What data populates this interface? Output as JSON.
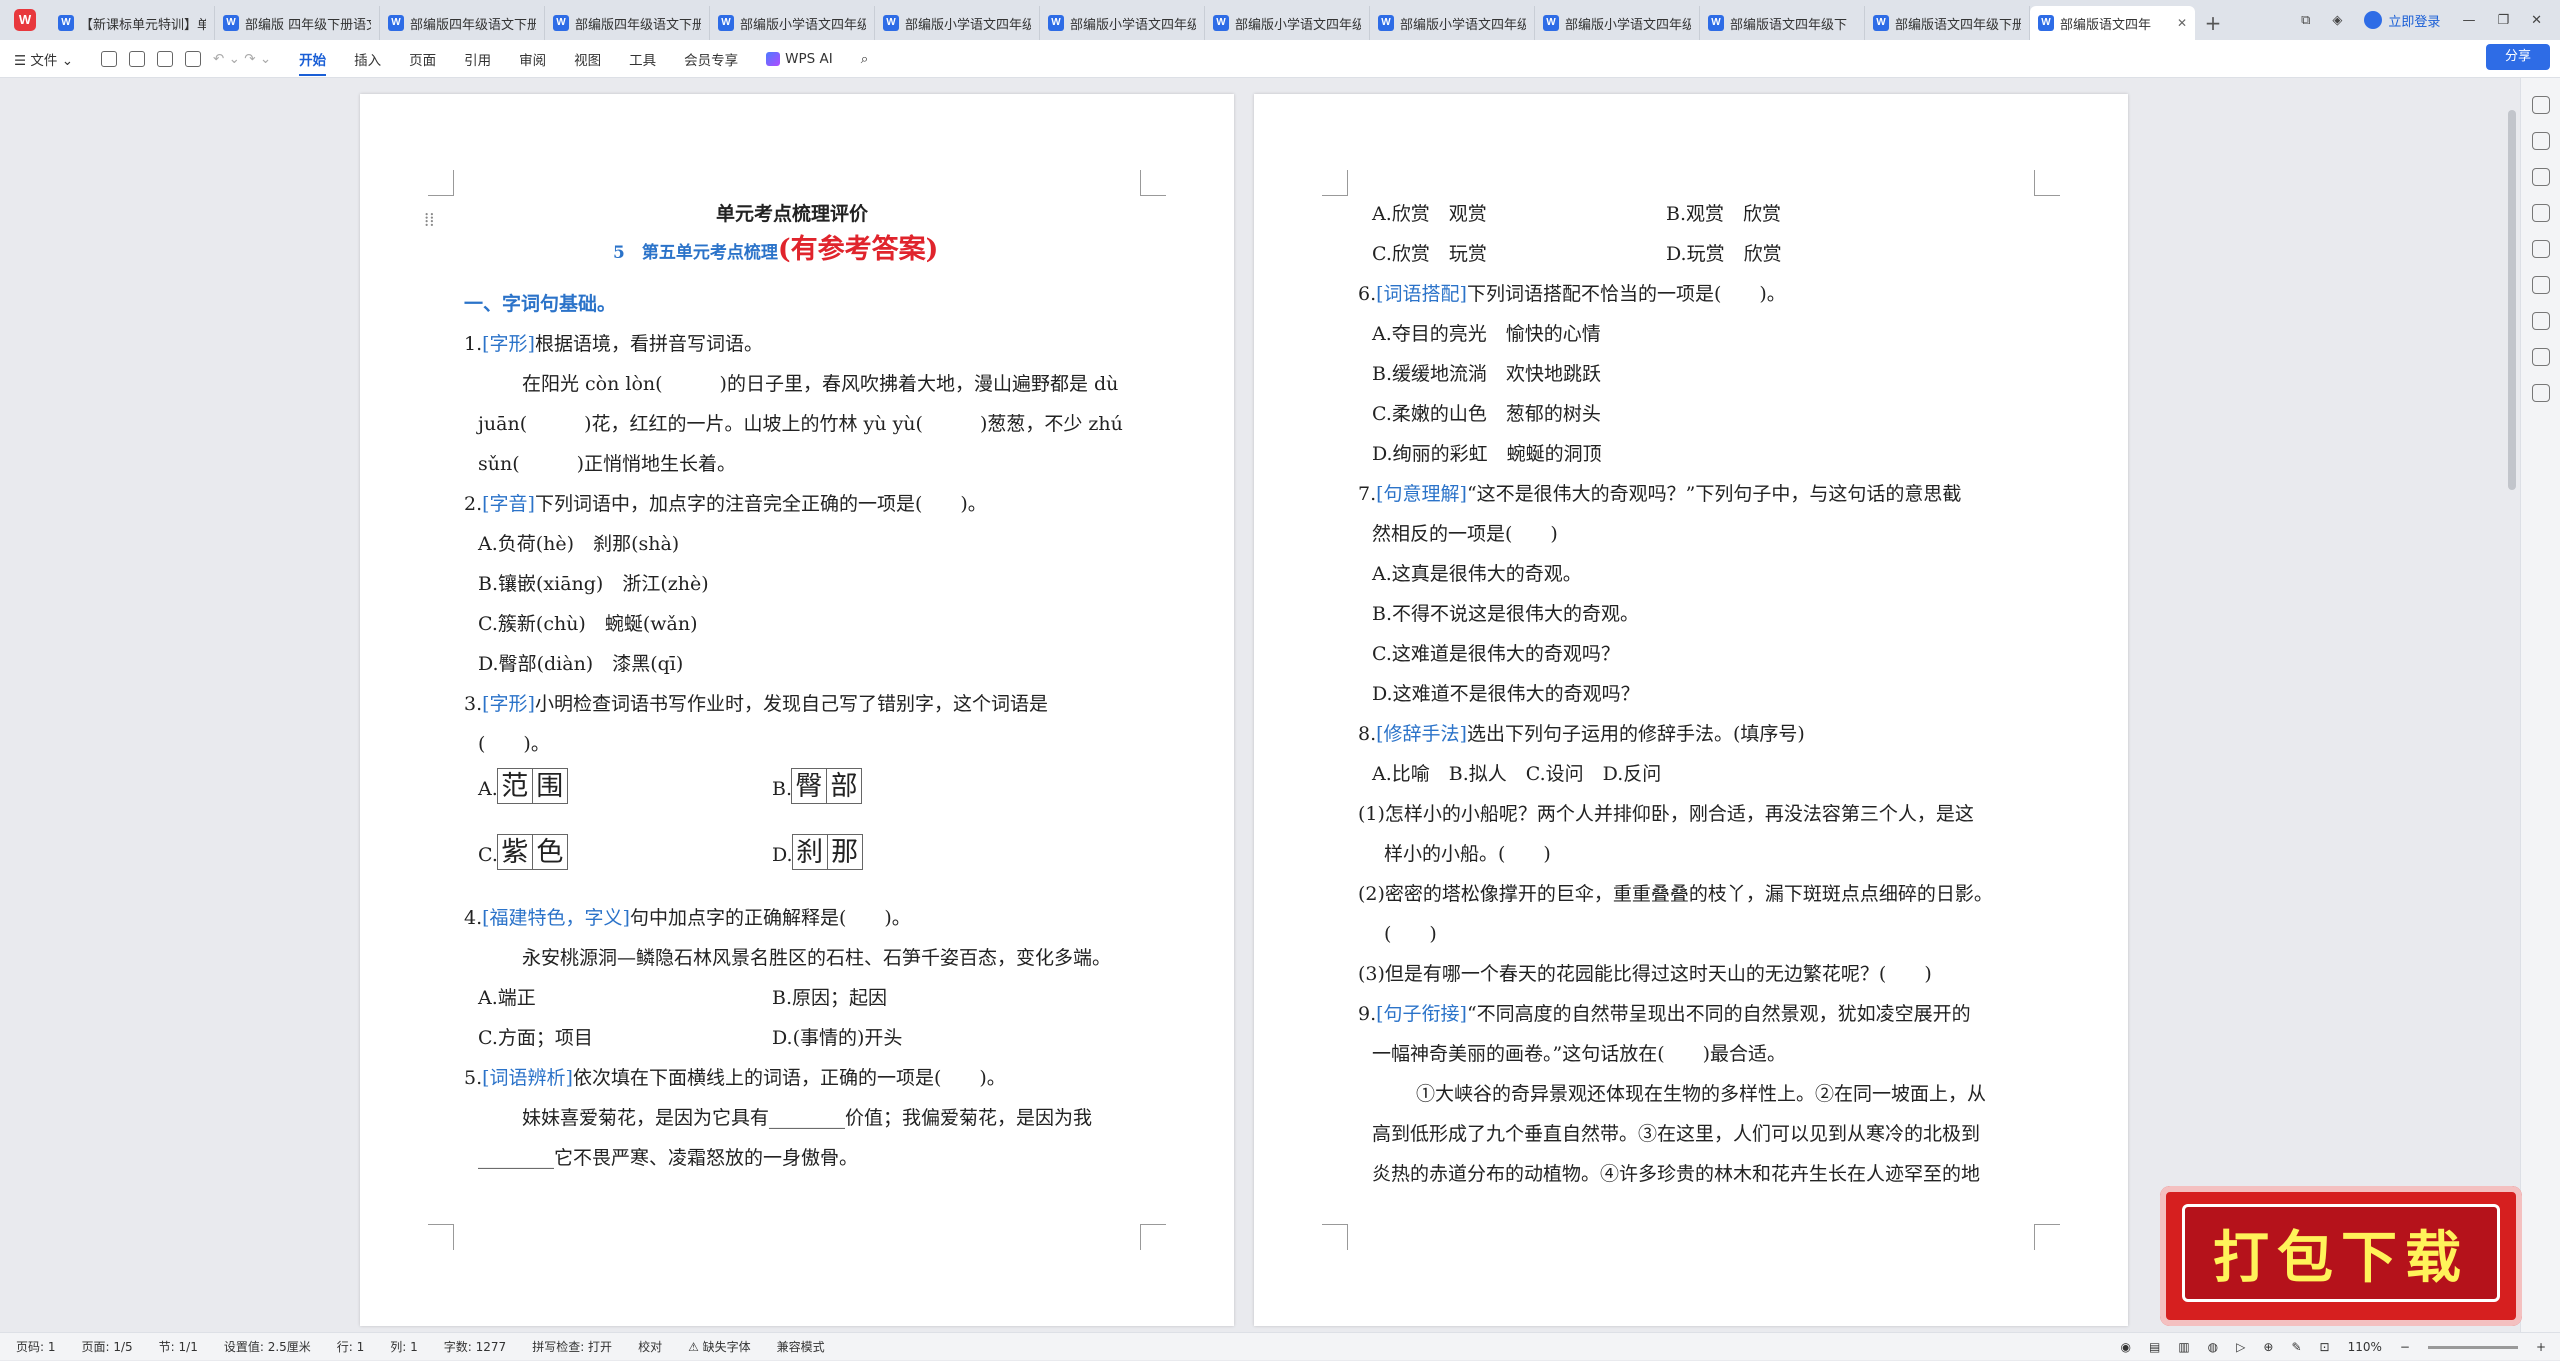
{
  "tabs": [
    {
      "label": "【新课标单元特训】单"
    },
    {
      "label": "部编版 四年级下册语文"
    },
    {
      "label": "部编版四年级语文下册"
    },
    {
      "label": "部编版四年级语文下册"
    },
    {
      "label": "部编版小学语文四年级"
    },
    {
      "label": "部编版小学语文四年级"
    },
    {
      "label": "部编版小学语文四年级"
    },
    {
      "label": "部编版小学语文四年级"
    },
    {
      "label": "部编版小学语文四年级"
    },
    {
      "label": "部编版小学语文四年级"
    },
    {
      "label": "部编版语文四年级下"
    },
    {
      "label": "部编版语文四年级下册"
    }
  ],
  "active_tab": {
    "label": "部编版语文四年"
  },
  "titlebar": {
    "login": "立即登录",
    "plus": "+"
  },
  "toolbar": {
    "file": "文件",
    "menus": [
      "开始",
      "插入",
      "页面",
      "引用",
      "审阅",
      "视图",
      "工具",
      "会员专享"
    ],
    "wps_ai": "WPS AI",
    "share": "分享"
  },
  "page1": {
    "header": "单元考点梳理评价",
    "subtitle": "5　第五单元考点梳理",
    "subtitle_red": "(有参考答案)",
    "section1": "一、字词句基础。",
    "q1_num": "1.",
    "q1_tag": "[字形]",
    "q1_text": "根据语境，看拼音写词语。",
    "q1_l1": "在阳光 còn lòn(　　　)的日子里，春风吹拂着大地，漫山遍野都是 dù",
    "q1_l2": "juān(　　　)花，红红的一片。山坡上的竹林 yù yù(　　　)葱葱，不少 zhú",
    "q1_l3": "sǔn(　　　)正悄悄地生长着。",
    "q2_num": "2.",
    "q2_tag": "[字音]",
    "q2_text": "下列词语中，加点字的注音完全正确的一项是(　　)。",
    "q2_a": "A.负荷(hè)　刹那(shà)",
    "q2_b": "B.镶嵌(xiāng)　浙江(zhè)",
    "q2_c": "C.簇新(chù)　蜿蜒(wǎn)",
    "q2_d": "D.臀部(diàn)　漆黑(qī)",
    "q3_num": "3.",
    "q3_tag": "[字形]",
    "q3_text": "小明检查词语书写作业时，发现自己写了错别字，这个词语是",
    "q3_l2": "(　　)。",
    "q3_a_label": "A.",
    "q3_a": [
      "范",
      "围"
    ],
    "q3_b_label": "B.",
    "q3_b": [
      "臀",
      "部"
    ],
    "q3_c_label": "C.",
    "q3_c": [
      "紫",
      "色"
    ],
    "q3_d_label": "D.",
    "q3_d": [
      "刹",
      "那"
    ],
    "q4_num": "4.",
    "q4_tag": "[福建特色，字义]",
    "q4_text": "句中加点字的正确解释是(　　)。",
    "q4_quote": "永安桃源洞—鳞隐石林风景名胜区的石柱、石笋千姿百态，变化多端。",
    "q4_a": "A.端正",
    "q4_b": "B.原因；起因",
    "q4_c": "C.方面；项目",
    "q4_d": "D.(事情的)开头",
    "q5_num": "5.",
    "q5_tag": "[词语辨析]",
    "q5_text": "依次填在下面横线上的词语，正确的一项是(　　)。",
    "q5_l1": "妹妹喜爱菊花，是因为它具有________价值；我偏爱菊花，是因为我",
    "q5_l2": "________它不畏严寒、凌霜怒放的一身傲骨。"
  },
  "page2": {
    "opt_a": "A.欣赏　观赏",
    "opt_b": "B.观赏　欣赏",
    "opt_c": "C.欣赏　玩赏",
    "opt_d": "D.玩赏　欣赏",
    "q6_num": "6.",
    "q6_tag": "[词语搭配]",
    "q6_text": "下列词语搭配不恰当的一项是(　　)。",
    "q6_a": "A.夺目的亮光　愉快的心情",
    "q6_b": "B.缓缓地流淌　欢快地跳跃",
    "q6_c": "C.柔嫩的山色　葱郁的树头",
    "q6_d": "D.绚丽的彩虹　蜿蜒的洞顶",
    "q7_num": "7.",
    "q7_tag": "[句意理解]",
    "q7_text": "“这不是很伟大的奇观吗？”下列句子中，与这句话的意思截",
    "q7_l2": "然相反的一项是(　　)",
    "q7_a": "A.这真是很伟大的奇观。",
    "q7_b": "B.不得不说这是很伟大的奇观。",
    "q7_c": "C.这难道是很伟大的奇观吗？",
    "q7_d": "D.这难道不是很伟大的奇观吗？",
    "q8_num": "8.",
    "q8_tag": "[修辞手法]",
    "q8_text": "选出下列句子运用的修辞手法。(填序号)",
    "q8_opts": "A.比喻　B.拟人　C.设问　D.反问",
    "q8_1": "(1)怎样小的小船呢？两个人并排仰卧，刚合适，再没法容第三个人，是这",
    "q8_1b": "样小的小船。(　　)",
    "q8_2": "(2)密密的塔松像撑开的巨伞，重重叠叠的枝丫，漏下斑斑点点细碎的日影。",
    "q8_2b": "(　　)",
    "q8_3": "(3)但是有哪一个春天的花园能比得过这时天山的无边繁花呢？(　　)",
    "q9_num": "9.",
    "q9_tag": "[句子衔接]",
    "q9_text": "“不同高度的自然带呈现出不同的自然景观，犹如凌空展开的",
    "q9_l2": "一幅神奇美丽的画卷。”这句话放在(　　)最合适。",
    "q9_l3": "①大峡谷的奇异景观还体现在生物的多样性上。②在同一坡面上，从",
    "q9_l4": "高到低形成了九个垂直自然带。③在这里，人们可以见到从寒冷的北极到",
    "q9_l5": "炎热的赤道分布的动植物。④许多珍贵的林木和花卉生长在人迹罕至的地"
  },
  "statusbar": {
    "page_code": "页码: 1",
    "pages": "页面: 1/5",
    "section": "节: 1/1",
    "setting": "设置值: 2.5厘米",
    "row": "行: 1",
    "col": "列: 1",
    "words": "字数: 1277",
    "spell": "拼写检查: 打开",
    "proof": "校对",
    "font_missing": "缺失字体",
    "compat": "兼容模式",
    "zoom": "110%"
  },
  "ad": {
    "text": "打包下载"
  }
}
